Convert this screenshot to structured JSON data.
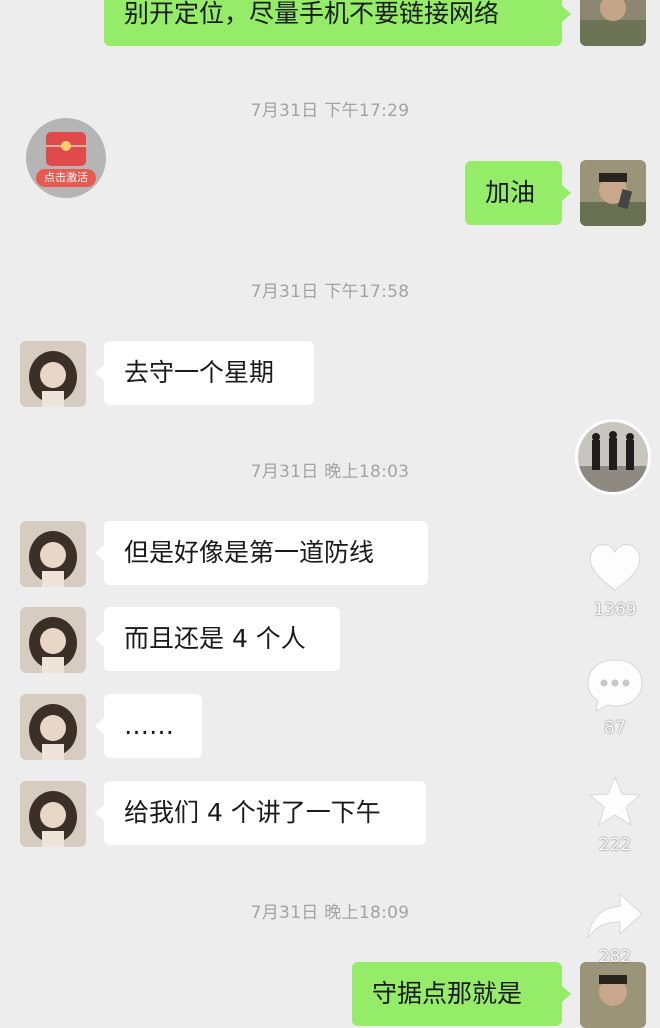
{
  "messages": [
    {
      "side": "out",
      "text": "别开定位，尽量手机不要链接网络"
    },
    {
      "timestamp": "7月31日 下午17:29"
    },
    {
      "side": "out",
      "text": "加油"
    },
    {
      "timestamp": "7月31日 下午17:58"
    },
    {
      "side": "in",
      "text": "去守一个星期"
    },
    {
      "timestamp": "7月31日 晚上18:03"
    },
    {
      "side": "in",
      "text": "但是好像是第一道防线"
    },
    {
      "side": "in",
      "text": "而且还是 4 个人"
    },
    {
      "side": "in",
      "text": "……"
    },
    {
      "side": "in",
      "text": "给我们 4 个讲了一下午"
    },
    {
      "timestamp": "7月31日 晚上18:09"
    },
    {
      "side": "out",
      "text": "守据点那就是"
    }
  ],
  "red_packet": {
    "label": "点击激活"
  },
  "sidebar": {
    "likes": "1369",
    "comments": "87",
    "favorites": "222",
    "shares": "282"
  },
  "colors": {
    "background": "#ededed",
    "outgoing_bubble": "#95ec69",
    "incoming_bubble": "#ffffff",
    "timestamp": "#a3a3a3"
  },
  "icons": [
    "heart-icon",
    "comment-icon",
    "star-icon",
    "share-icon",
    "red-packet-icon"
  ]
}
